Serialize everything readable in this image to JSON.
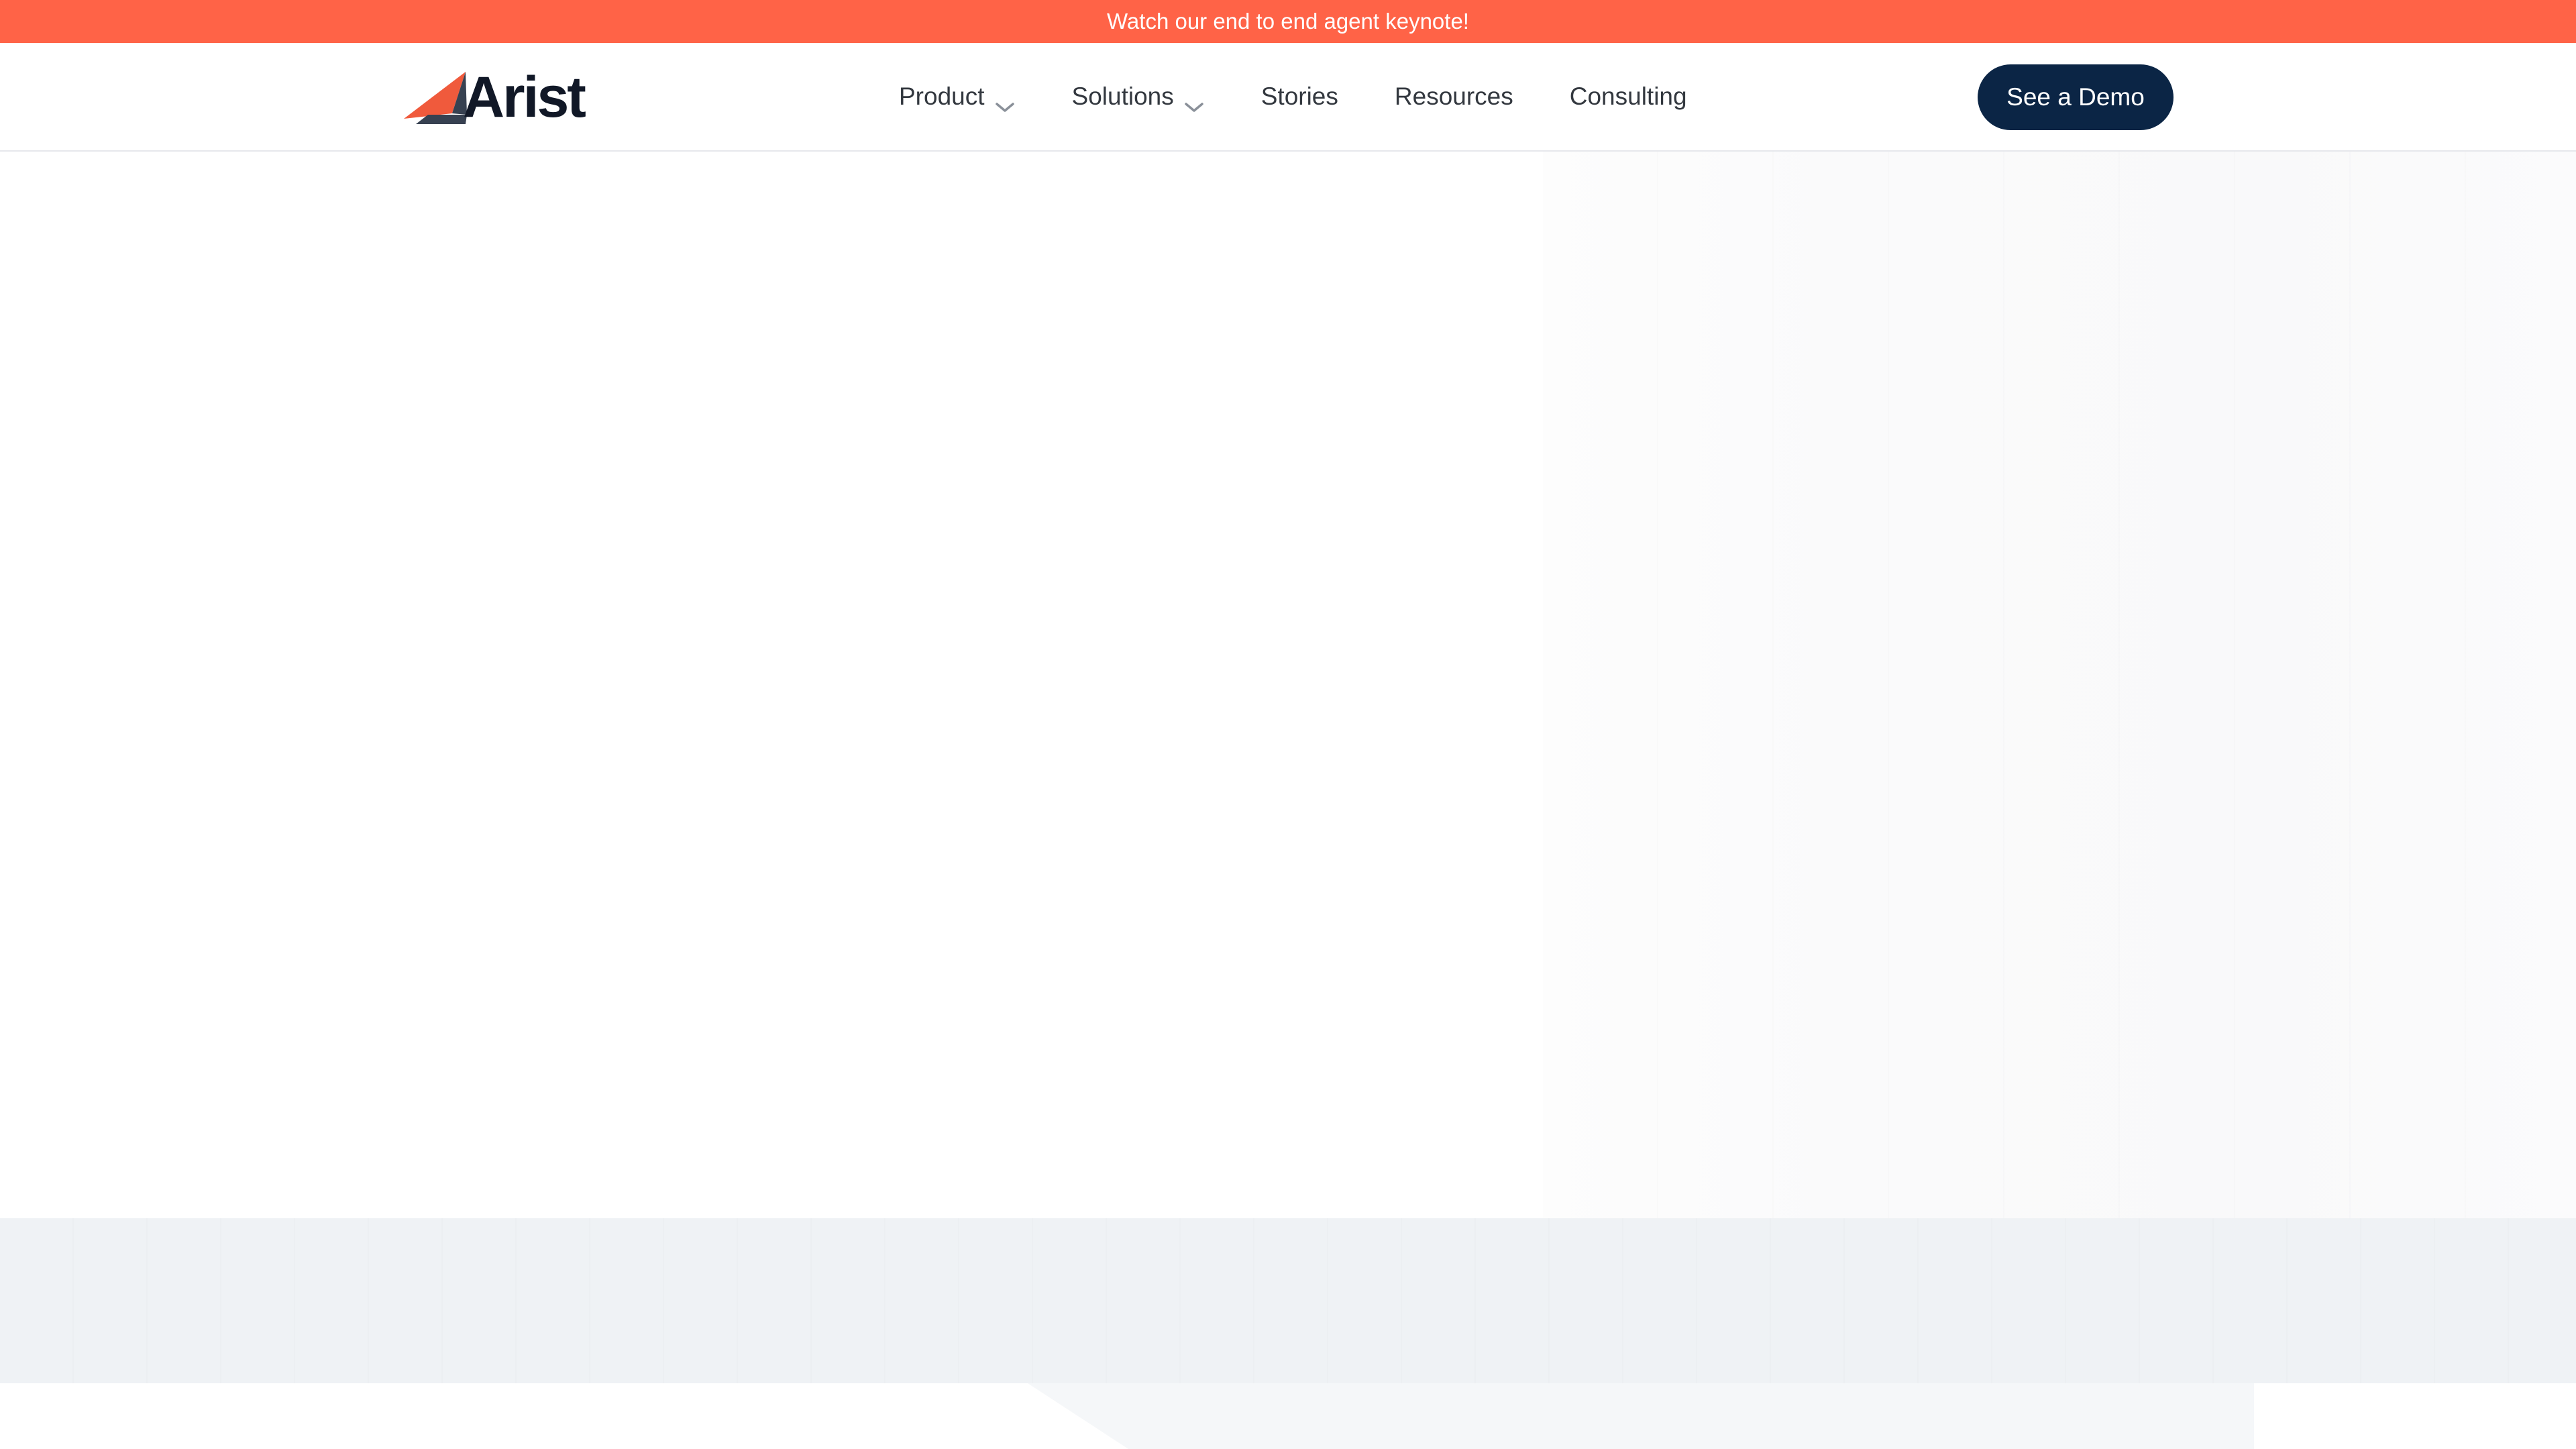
{
  "announcement": {
    "text": "Watch our end to end agent keynote!"
  },
  "header": {
    "logo_text": "Arist",
    "nav": {
      "product": "Product",
      "solutions": "Solutions",
      "stories": "Stories",
      "resources": "Resources",
      "consulting": "Consulting"
    },
    "cta_label": "See a Demo"
  },
  "colors": {
    "announcement_bg": "#ff6347",
    "cta_bg": "#0b2545",
    "logo_accent": "#f05a3c",
    "logo_dark": "#374151",
    "band_bg": "#eff2f5"
  },
  "icons": {
    "logo_mark": "arist-logo-icon",
    "dropdown": "chevron-down-icon"
  }
}
